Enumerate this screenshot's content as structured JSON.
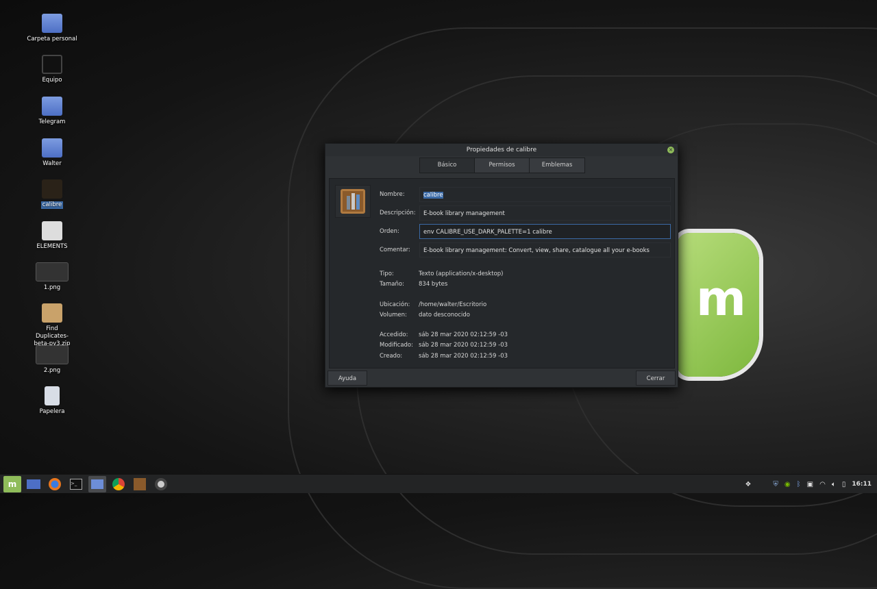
{
  "desktop": {
    "icons": [
      {
        "label": "Carpeta personal",
        "icon": "home-folder-icon"
      },
      {
        "label": "Equipo",
        "icon": "computer-icon"
      },
      {
        "label": "Telegram",
        "icon": "folder-icon"
      },
      {
        "label": "Walter",
        "icon": "folder-icon"
      },
      {
        "label": "calibre",
        "icon": "calibre-icon",
        "selected": true
      },
      {
        "label": "ELEMENTS",
        "icon": "drive-icon"
      },
      {
        "label": "1.png",
        "icon": "image-icon"
      },
      {
        "label": "Find Duplicates-beta-py3.zip",
        "icon": "archive-icon"
      },
      {
        "label": "2.png",
        "icon": "image-icon"
      },
      {
        "label": "Papelera",
        "icon": "trash-icon"
      }
    ]
  },
  "dialog": {
    "title": "Propiedades de calibre",
    "tabs": [
      "Básico",
      "Permisos",
      "Emblemas"
    ],
    "fields": {
      "name_label": "Nombre:",
      "name_value": "calibre",
      "desc_label": "Descripción:",
      "desc_value": "E-book library management",
      "cmd_label": "Orden:",
      "cmd_value": "env CALIBRE_USE_DARK_PALETTE=1 calibre",
      "comment_label": "Comentar:",
      "comment_value": "E-book library management: Convert, view, share, catalogue all your e-books"
    },
    "info": [
      {
        "label": "Tipo:",
        "value": "Texto (application/x-desktop)"
      },
      {
        "label": "Tamaño:",
        "value": "834 bytes"
      },
      {
        "label": "Ubicación:",
        "value": "/home/walter/Escritorio"
      },
      {
        "label": "Volumen:",
        "value": "dato desconocido"
      },
      {
        "label": "Accedido:",
        "value": "sáb 28 mar 2020 02:12:59 -03"
      },
      {
        "label": "Modificado:",
        "value": "sáb 28 mar 2020 02:12:59 -03"
      },
      {
        "label": "Creado:",
        "value": "sáb 28 mar 2020 02:12:59 -03"
      }
    ],
    "help_label": "Ayuda",
    "close_label": "Cerrar"
  },
  "taskbar": {
    "clock": "16:11"
  },
  "colors": {
    "accent": "#3b6aa6",
    "mint": "#8fbc5a"
  }
}
